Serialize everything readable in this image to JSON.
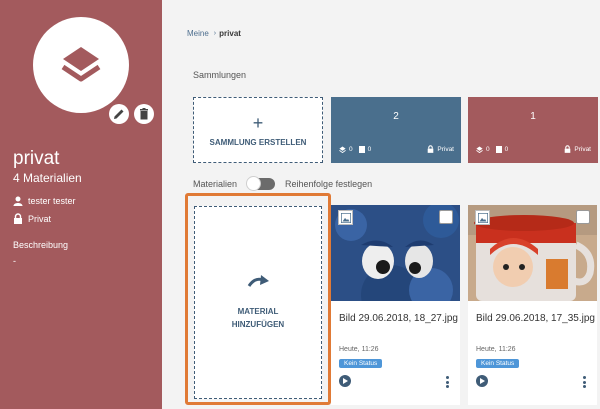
{
  "sidebar": {
    "title": "privat",
    "count": "4 Materialien",
    "owner": "tester tester",
    "visibility": "Privat",
    "description_label": "Beschreibung",
    "description_value": "-"
  },
  "breadcrumb": {
    "root": "Meine",
    "separator": "›",
    "current": "privat"
  },
  "collections": {
    "section_label": "Sammlungen",
    "create_label": "SAMMLUNG ERSTELLEN",
    "items": [
      {
        "number": "2",
        "subcollections": "0",
        "materials": "0",
        "visibility": "Privat",
        "color": "#4a6f8d"
      },
      {
        "number": "1",
        "subcollections": "0",
        "materials": "0",
        "visibility": "Privat",
        "color": "#a35a5d"
      }
    ]
  },
  "materials": {
    "section_label": "Materialien",
    "order_label": "Reihenfolge festlegen",
    "add_label": "MATERIAL\nHINZUFÜGEN",
    "items": [
      {
        "title": "Bild 29.06.2018, 18_27.jpg",
        "date": "Heute, 11:26",
        "status": "Kein Status"
      },
      {
        "title": "Bild 29.06.2018, 17_35.jpg",
        "date": "Heute, 11:26",
        "status": "Kein Status"
      }
    ]
  },
  "colors": {
    "sidebar": "#a35a5d",
    "accent_blue": "#4a6f8d",
    "highlight": "#e07a36",
    "badge": "#4e96d8"
  }
}
